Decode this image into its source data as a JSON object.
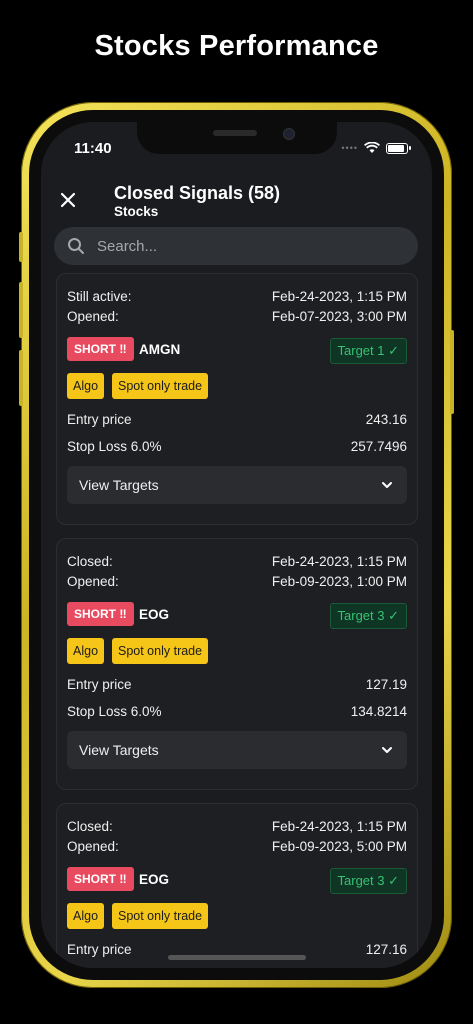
{
  "headline": "Stocks Performance",
  "status": {
    "time": "11:40"
  },
  "header": {
    "title": "Closed Signals (58)",
    "subtitle": "Stocks"
  },
  "search": {
    "placeholder": "Search..."
  },
  "cards": [
    {
      "status_label": "Still active:",
      "status_date": "Feb-24-2023, 1:15 PM",
      "opened_label": "Opened:",
      "opened_date": "Feb-07-2023, 3:00 PM",
      "direction": "SHORT ‼",
      "ticker": "AMGN",
      "target": "Target 1 ✓",
      "tags": [
        "Algo",
        "Spot only trade"
      ],
      "entry_label": "Entry price",
      "entry_value": "243.16",
      "stop_label": "Stop Loss 6.0%",
      "stop_value": "257.7496",
      "view_targets": "View Targets"
    },
    {
      "status_label": "Closed:",
      "status_date": "Feb-24-2023, 1:15 PM",
      "opened_label": "Opened:",
      "opened_date": "Feb-09-2023, 1:00 PM",
      "direction": "SHORT ‼",
      "ticker": "EOG",
      "target": "Target 3 ✓",
      "tags": [
        "Algo",
        "Spot only trade"
      ],
      "entry_label": "Entry price",
      "entry_value": "127.19",
      "stop_label": "Stop Loss 6.0%",
      "stop_value": "134.8214",
      "view_targets": "View Targets"
    },
    {
      "status_label": "Closed:",
      "status_date": "Feb-24-2023, 1:15 PM",
      "opened_label": "Opened:",
      "opened_date": "Feb-09-2023, 5:00 PM",
      "direction": "SHORT ‼",
      "ticker": "EOG",
      "target": "Target 3 ✓",
      "tags": [
        "Algo",
        "Spot only trade"
      ],
      "entry_label": "Entry price",
      "entry_value": "127.16"
    }
  ],
  "colors": {
    "background": "#1b1c1f",
    "short": "#e84a5f",
    "target_text": "#38c172",
    "tag": "#f5c518",
    "frame": "#d8c334"
  },
  "icons": [
    "close-icon",
    "search-icon",
    "chevron-down-icon",
    "wifi-icon",
    "battery-icon"
  ]
}
